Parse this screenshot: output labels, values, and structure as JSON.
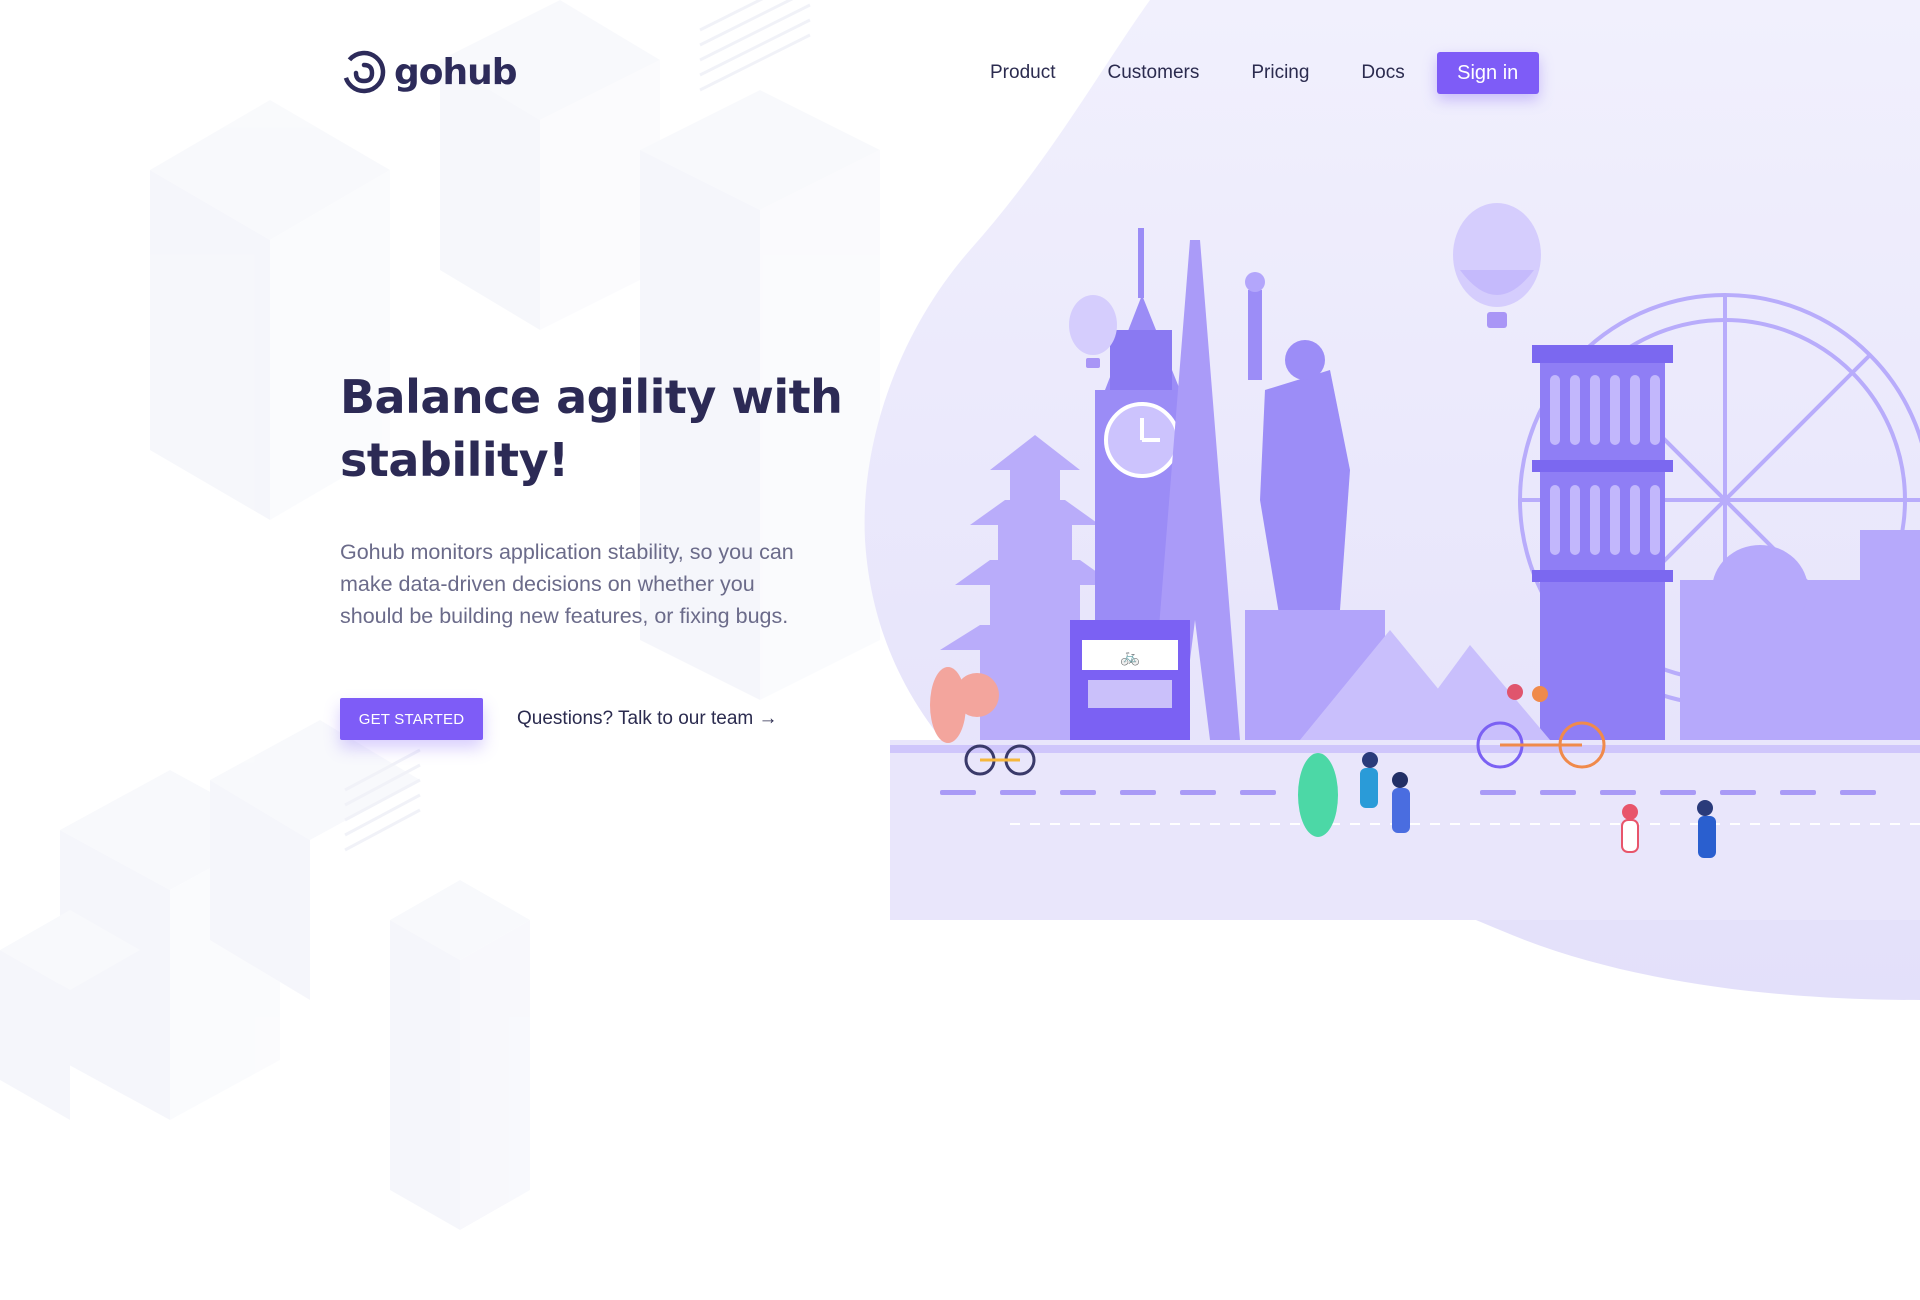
{
  "brand": {
    "name": "gohub",
    "accent": "#7e5cf7",
    "text_color": "#2c2a55"
  },
  "nav": {
    "items": [
      {
        "label": "Product"
      },
      {
        "label": "Customers"
      },
      {
        "label": "Pricing"
      },
      {
        "label": "Docs"
      }
    ],
    "signin_label": "Sign in"
  },
  "hero": {
    "title_line1": "Balance agility with",
    "title_line2": "stability!",
    "description": "Gohub monitors application stability, so you can make data-driven decisions on whether you should be building new features, or fixing bugs.",
    "primary_cta": "GET STARTED",
    "secondary_cta": "Questions? Talk to our team →"
  },
  "illustration": {
    "icon": "city-landmarks-illustration",
    "bike_sign": "🚲"
  }
}
